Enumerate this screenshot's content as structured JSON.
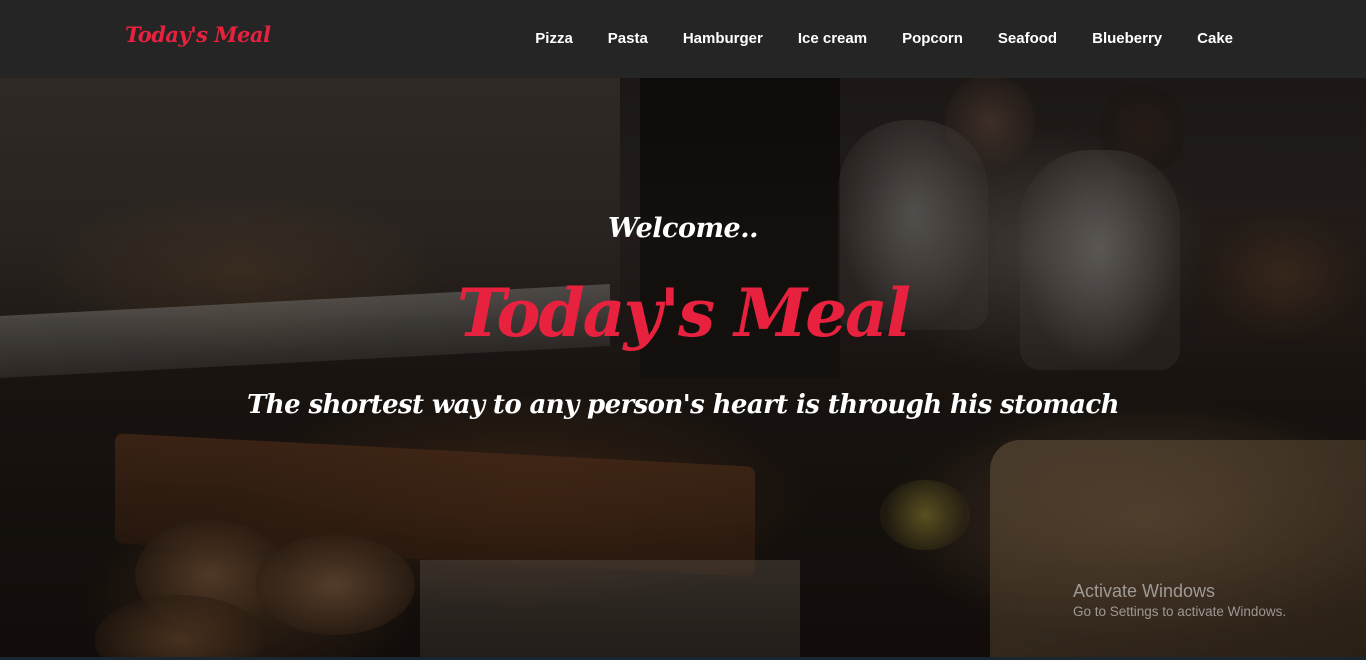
{
  "navbar": {
    "brand": "Today's Meal",
    "links": [
      "Pizza",
      "Pasta",
      "Hamburger",
      "Ice cream",
      "Popcorn",
      "Seafood",
      "Blueberry",
      "Cake"
    ]
  },
  "hero": {
    "welcome": "Welcome..",
    "title": "Today's Meal",
    "tagline": "The shortest way to any person's heart is through his stomach"
  },
  "watermark": {
    "title": "Activate Windows",
    "subtitle": "Go to Settings to activate Windows."
  },
  "colors": {
    "accent": "#e8213f",
    "navbar_bg": "#262626",
    "text_light": "#ffffff"
  }
}
